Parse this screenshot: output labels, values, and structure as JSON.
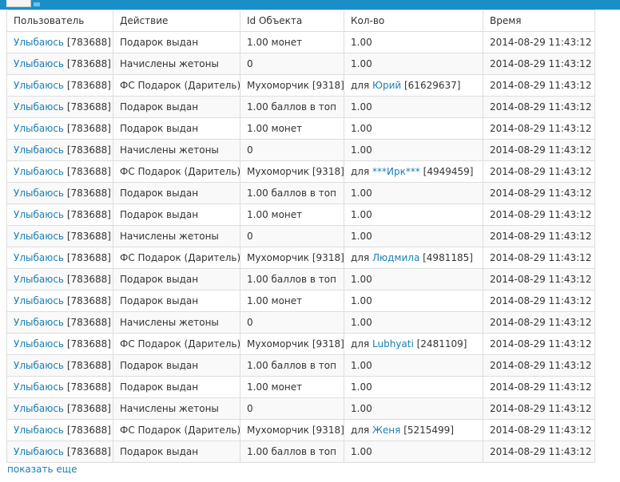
{
  "columns": [
    "Пользователь",
    "Действие",
    "Id Объекта",
    "Кол-во",
    "Время"
  ],
  "rows": [
    {
      "user_name": "Улыбаюсь",
      "user_id": "[783688]",
      "action": "Подарок выдан",
      "object": "1.00 монет",
      "qty_prefix": "",
      "qty_link": "",
      "qty_suffix": "1.00",
      "time": "2014-08-29 11:43:12"
    },
    {
      "user_name": "Улыбаюсь",
      "user_id": "[783688]",
      "action": "Начислены жетоны",
      "object": "0",
      "qty_prefix": "",
      "qty_link": "",
      "qty_suffix": "1.00",
      "time": "2014-08-29 11:43:12"
    },
    {
      "user_name": "Улыбаюсь",
      "user_id": "[783688]",
      "action": "ФС Подарок (Даритель)",
      "object": "Мухоморчик [9318]",
      "qty_prefix": "для ",
      "qty_link": "Юрий",
      "qty_suffix": " [61629637]",
      "time": "2014-08-29 11:43:12"
    },
    {
      "user_name": "Улыбаюсь",
      "user_id": "[783688]",
      "action": "Подарок выдан",
      "object": "1.00 баллов в топ",
      "qty_prefix": "",
      "qty_link": "",
      "qty_suffix": "1.00",
      "time": "2014-08-29 11:43:12"
    },
    {
      "user_name": "Улыбаюсь",
      "user_id": "[783688]",
      "action": "Подарок выдан",
      "object": "1.00 монет",
      "qty_prefix": "",
      "qty_link": "",
      "qty_suffix": "1.00",
      "time": "2014-08-29 11:43:12"
    },
    {
      "user_name": "Улыбаюсь",
      "user_id": "[783688]",
      "action": "Начислены жетоны",
      "object": "0",
      "qty_prefix": "",
      "qty_link": "",
      "qty_suffix": "1.00",
      "time": "2014-08-29 11:43:12"
    },
    {
      "user_name": "Улыбаюсь",
      "user_id": "[783688]",
      "action": "ФС Подарок (Даритель)",
      "object": "Мухоморчик [9318]",
      "qty_prefix": "для ",
      "qty_link": "***Ирк***",
      "qty_suffix": " [4949459]",
      "time": "2014-08-29 11:43:12"
    },
    {
      "user_name": "Улыбаюсь",
      "user_id": "[783688]",
      "action": "Подарок выдан",
      "object": "1.00 баллов в топ",
      "qty_prefix": "",
      "qty_link": "",
      "qty_suffix": "1.00",
      "time": "2014-08-29 11:43:12"
    },
    {
      "user_name": "Улыбаюсь",
      "user_id": "[783688]",
      "action": "Подарок выдан",
      "object": "1.00 монет",
      "qty_prefix": "",
      "qty_link": "",
      "qty_suffix": "1.00",
      "time": "2014-08-29 11:43:12"
    },
    {
      "user_name": "Улыбаюсь",
      "user_id": "[783688]",
      "action": "Начислены жетоны",
      "object": "0",
      "qty_prefix": "",
      "qty_link": "",
      "qty_suffix": "1.00",
      "time": "2014-08-29 11:43:12"
    },
    {
      "user_name": "Улыбаюсь",
      "user_id": "[783688]",
      "action": "ФС Подарок (Даритель)",
      "object": "Мухоморчик [9318]",
      "qty_prefix": "для ",
      "qty_link": "Людмила",
      "qty_suffix": " [4981185]",
      "time": "2014-08-29 11:43:12"
    },
    {
      "user_name": "Улыбаюсь",
      "user_id": "[783688]",
      "action": "Подарок выдан",
      "object": "1.00 баллов в топ",
      "qty_prefix": "",
      "qty_link": "",
      "qty_suffix": "1.00",
      "time": "2014-08-29 11:43:12"
    },
    {
      "user_name": "Улыбаюсь",
      "user_id": "[783688]",
      "action": "Подарок выдан",
      "object": "1.00 монет",
      "qty_prefix": "",
      "qty_link": "",
      "qty_suffix": "1.00",
      "time": "2014-08-29 11:43:12"
    },
    {
      "user_name": "Улыбаюсь",
      "user_id": "[783688]",
      "action": "Начислены жетоны",
      "object": "0",
      "qty_prefix": "",
      "qty_link": "",
      "qty_suffix": "1.00",
      "time": "2014-08-29 11:43:12"
    },
    {
      "user_name": "Улыбаюсь",
      "user_id": "[783688]",
      "action": "ФС Подарок (Даритель)",
      "object": "Мухоморчик [9318]",
      "qty_prefix": "для ",
      "qty_link": "Lubhyati",
      "qty_suffix": " [2481109]",
      "time": "2014-08-29 11:43:12"
    },
    {
      "user_name": "Улыбаюсь",
      "user_id": "[783688]",
      "action": "Подарок выдан",
      "object": "1.00 баллов в топ",
      "qty_prefix": "",
      "qty_link": "",
      "qty_suffix": "1.00",
      "time": "2014-08-29 11:43:12"
    },
    {
      "user_name": "Улыбаюсь",
      "user_id": "[783688]",
      "action": "Подарок выдан",
      "object": "1.00 монет",
      "qty_prefix": "",
      "qty_link": "",
      "qty_suffix": "1.00",
      "time": "2014-08-29 11:43:12"
    },
    {
      "user_name": "Улыбаюсь",
      "user_id": "[783688]",
      "action": "Начислены жетоны",
      "object": "0",
      "qty_prefix": "",
      "qty_link": "",
      "qty_suffix": "1.00",
      "time": "2014-08-29 11:43:12"
    },
    {
      "user_name": "Улыбаюсь",
      "user_id": "[783688]",
      "action": "ФС Подарок (Даритель)",
      "object": "Мухоморчик [9318]",
      "qty_prefix": "для ",
      "qty_link": "Женя",
      "qty_suffix": " [5215499]",
      "time": "2014-08-29 11:43:12"
    },
    {
      "user_name": "Улыбаюсь",
      "user_id": "[783688]",
      "action": "Подарок выдан",
      "object": "1.00 баллов в топ",
      "qty_prefix": "",
      "qty_link": "",
      "qty_suffix": "1.00",
      "time": "2014-08-29 11:43:12"
    }
  ],
  "show_more_label": "показать еще",
  "colors": {
    "link": "#1a7fb5",
    "header_bar": "#1a8fc7",
    "border": "#dddddd"
  }
}
